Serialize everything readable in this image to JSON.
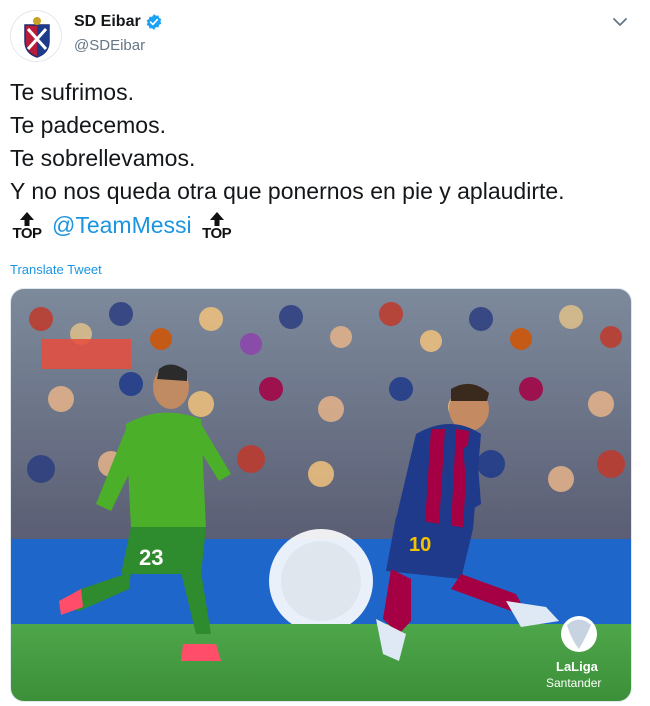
{
  "user": {
    "name": "SD Eibar",
    "handle": "@SDEibar"
  },
  "tweet": {
    "lines": [
      "Te sufrimos.",
      "Te padecemos.",
      "Te sobrellevamos.",
      "Y no nos queda otra que ponernos en pie y aplaudirte."
    ],
    "mention": "@TeamMessi",
    "emoji_text": "TOP",
    "translate_label": "Translate Tweet"
  },
  "media": {
    "player_left_number": "23",
    "player_right_number": "10",
    "watermark_line1": "LaLiga",
    "watermark_line2": "Santander"
  },
  "colors": {
    "link": "#1b95e0",
    "verified": "#1da1f2",
    "eibar_green": "#4caf2a",
    "barca_blue": "#1f3a8a",
    "barca_red": "#a50044",
    "pitch": "#3f9a3a"
  }
}
